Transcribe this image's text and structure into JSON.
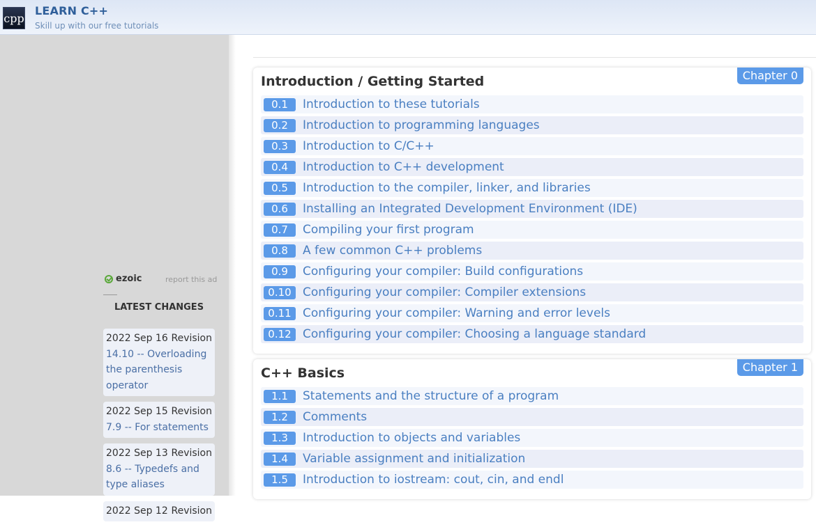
{
  "header": {
    "logo_text": "cpp",
    "title": "LEARN C++",
    "tagline": "Skill up with our free tutorials"
  },
  "sidebar": {
    "ad_brand": "ezoic",
    "report_ad": "report this ad",
    "latest_heading": "LATEST CHANGES",
    "changes": [
      {
        "date": "2022 Sep 16",
        "type": "Revision",
        "link": "14.10 -- Overloading the parenthesis operator"
      },
      {
        "date": "2022 Sep 15",
        "type": "Revision",
        "link": "7.9 -- For statements"
      },
      {
        "date": "2022 Sep 13",
        "type": "Revision",
        "link": "8.6 -- Typedefs and type aliases"
      },
      {
        "date": "2022 Sep 12",
        "type": "Revision",
        "link": ""
      }
    ]
  },
  "chapters": [
    {
      "title": "Introduction / Getting Started",
      "badge": "Chapter 0",
      "lessons": [
        {
          "num": "0.1",
          "title": "Introduction to these tutorials"
        },
        {
          "num": "0.2",
          "title": "Introduction to programming languages"
        },
        {
          "num": "0.3",
          "title": "Introduction to C/C++"
        },
        {
          "num": "0.4",
          "title": "Introduction to C++ development"
        },
        {
          "num": "0.5",
          "title": "Introduction to the compiler, linker, and libraries"
        },
        {
          "num": "0.6",
          "title": "Installing an Integrated Development Environment (IDE)"
        },
        {
          "num": "0.7",
          "title": "Compiling your first program"
        },
        {
          "num": "0.8",
          "title": "A few common C++ problems"
        },
        {
          "num": "0.9",
          "title": "Configuring your compiler: Build configurations"
        },
        {
          "num": "0.10",
          "title": "Configuring your compiler: Compiler extensions"
        },
        {
          "num": "0.11",
          "title": "Configuring your compiler: Warning and error levels"
        },
        {
          "num": "0.12",
          "title": "Configuring your compiler: Choosing a language standard"
        }
      ]
    },
    {
      "title": "C++ Basics",
      "badge": "Chapter 1",
      "lessons": [
        {
          "num": "1.1",
          "title": "Statements and the structure of a program"
        },
        {
          "num": "1.2",
          "title": "Comments"
        },
        {
          "num": "1.3",
          "title": "Introduction to objects and variables"
        },
        {
          "num": "1.4",
          "title": "Variable assignment and initialization"
        },
        {
          "num": "1.5",
          "title": "Introduction to iostream: cout, cin, and endl"
        }
      ]
    }
  ]
}
